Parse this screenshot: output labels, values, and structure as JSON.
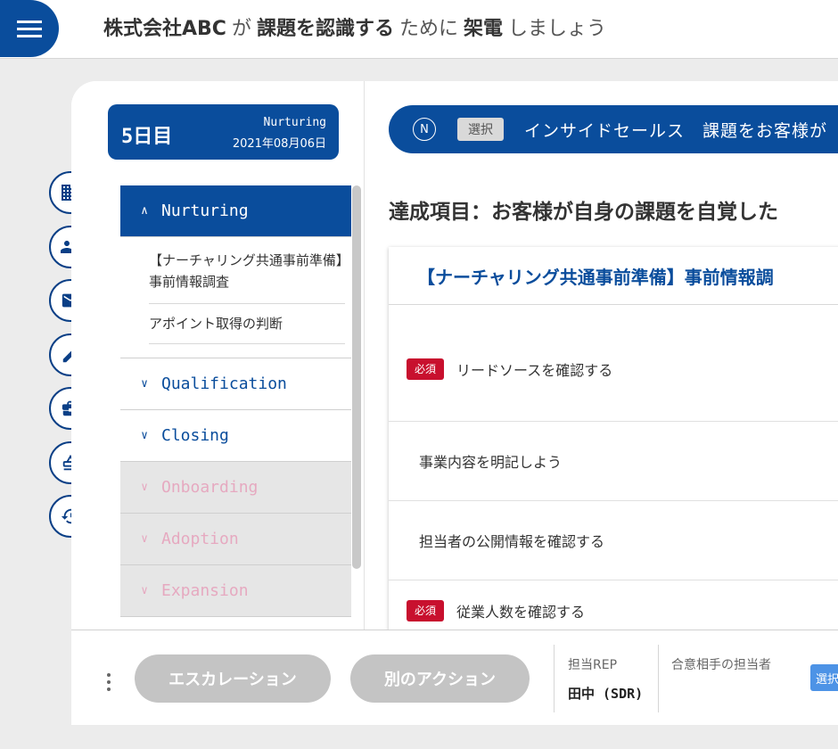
{
  "header": {
    "company": "株式会社ABC",
    "particle_ga": "が",
    "purpose": "課題を認識する",
    "particle_tame": "ために",
    "action": "架電",
    "suffix": "しましょう"
  },
  "rail": {
    "icons": [
      "building-icon",
      "people-icon",
      "mail-icon",
      "pencil-icon",
      "briefcase-icon",
      "stamp-icon",
      "history-icon"
    ]
  },
  "day_card": {
    "day": "5日目",
    "phase": "Nurturing",
    "date": "2021年08月06日"
  },
  "phases": {
    "nurturing": "Nurturing",
    "nurturing_items": [
      "【ナーチャリング共通事前準備】事前情報調査",
      "アポイント取得の判断"
    ],
    "qualification": "Qualification",
    "closing": "Closing",
    "onboarding": "Onboarding",
    "adoption": "Adoption",
    "expansion": "Expansion"
  },
  "stage": {
    "badge": "N",
    "select_label": "選択",
    "text": "インサイドセールス　課題をお客様が"
  },
  "goal": "達成項目：お客様が自身の課題を自覚した",
  "task_card": {
    "title": "【ナーチャリング共通事前準備】事前情報調",
    "required_label": "必須",
    "rows": [
      "リードソースを確認する",
      "事業内容を明記しよう",
      "担当者の公開情報を確認する",
      "従業人数を確認する"
    ]
  },
  "footer": {
    "escalation": "エスカレーション",
    "other_action": "別のアクション",
    "rep_label": "担当REP",
    "rep_value": "田中 (SDR)",
    "agreed_label": "合意相手の担当者",
    "select_label": "選択"
  },
  "colors": {
    "primary": "#0a4d9c",
    "required": "#c8102e",
    "disabled_text": "#e6a9c0",
    "select_blue": "#4d93e6"
  }
}
